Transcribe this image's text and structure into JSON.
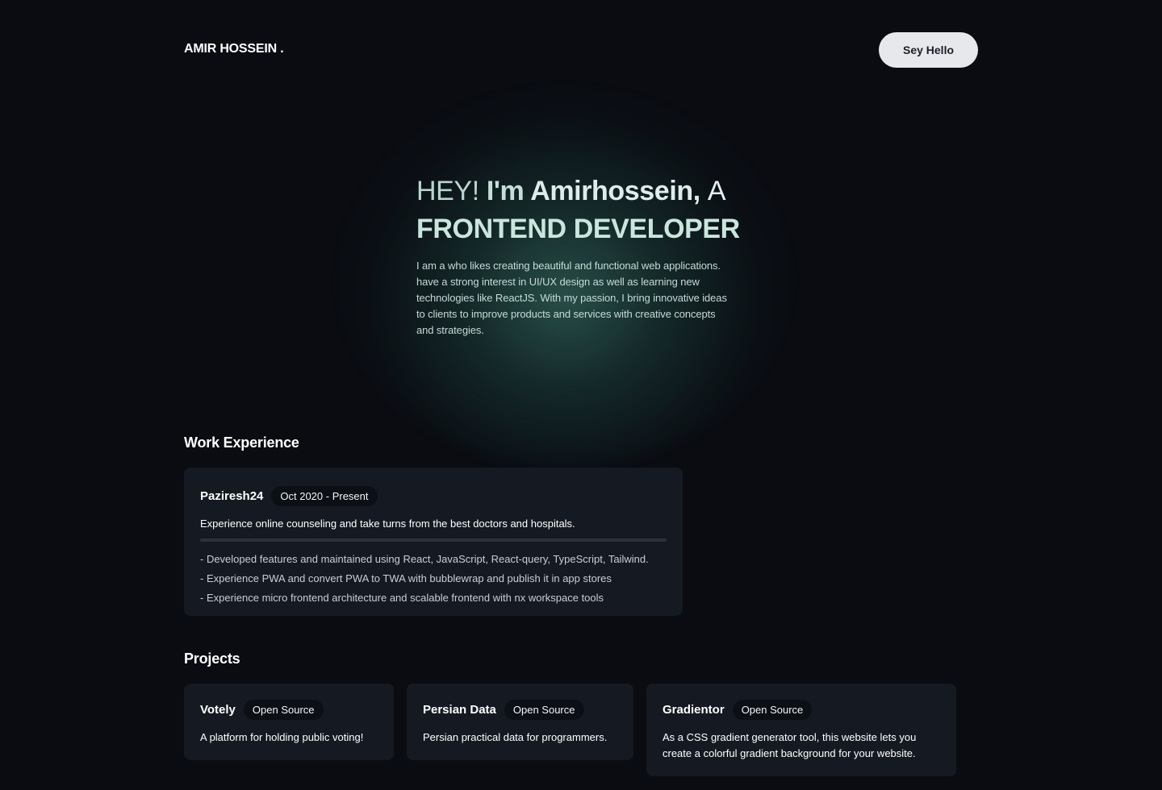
{
  "header": {
    "brand": "AMIR HOSSEIN .",
    "hello_button": "Sey Hello"
  },
  "hero": {
    "hey": "HEY!",
    "im": "I'm",
    "name": "Amirhossein,",
    "a": "A",
    "role": "FRONTEND DEVELOPER",
    "bio_lines": [
      "I am a who likes creating beautiful and functional web applications.",
      "have a strong interest in UI/UX design as well as learning new",
      "technologies like ReactJS. With my passion, I bring innovative ideas",
      "to clients to improve products and services with creative concepts",
      "and strategies."
    ]
  },
  "work": {
    "title": "Work Experience",
    "items": [
      {
        "company": "Paziresh24",
        "period": "Oct 2020 - Present",
        "description": "Experience online counseling and take turns from the best doctors and hospitals.",
        "bullets": [
          "- Developed features and maintained using React, JavaScript, React-query, TypeScript, Tailwind.",
          "- Experience PWA and convert PWA to TWA with bubblewrap and publish it in app stores",
          "- Experience micro frontend architecture and scalable frontend with nx workspace tools"
        ]
      }
    ]
  },
  "projects": {
    "title": "Projects",
    "items": [
      {
        "name": "Votely",
        "badge": "Open Source",
        "description": "A platform for holding public voting!"
      },
      {
        "name": "Persian Data",
        "badge": "Open Source",
        "description": "Persian practical data for programmers."
      },
      {
        "name": "Gradientor",
        "badge": "Open Source",
        "description_lines": [
          "As a CSS gradient generator tool, this website lets you",
          "create a colorful gradient background for your website."
        ]
      }
    ]
  }
}
